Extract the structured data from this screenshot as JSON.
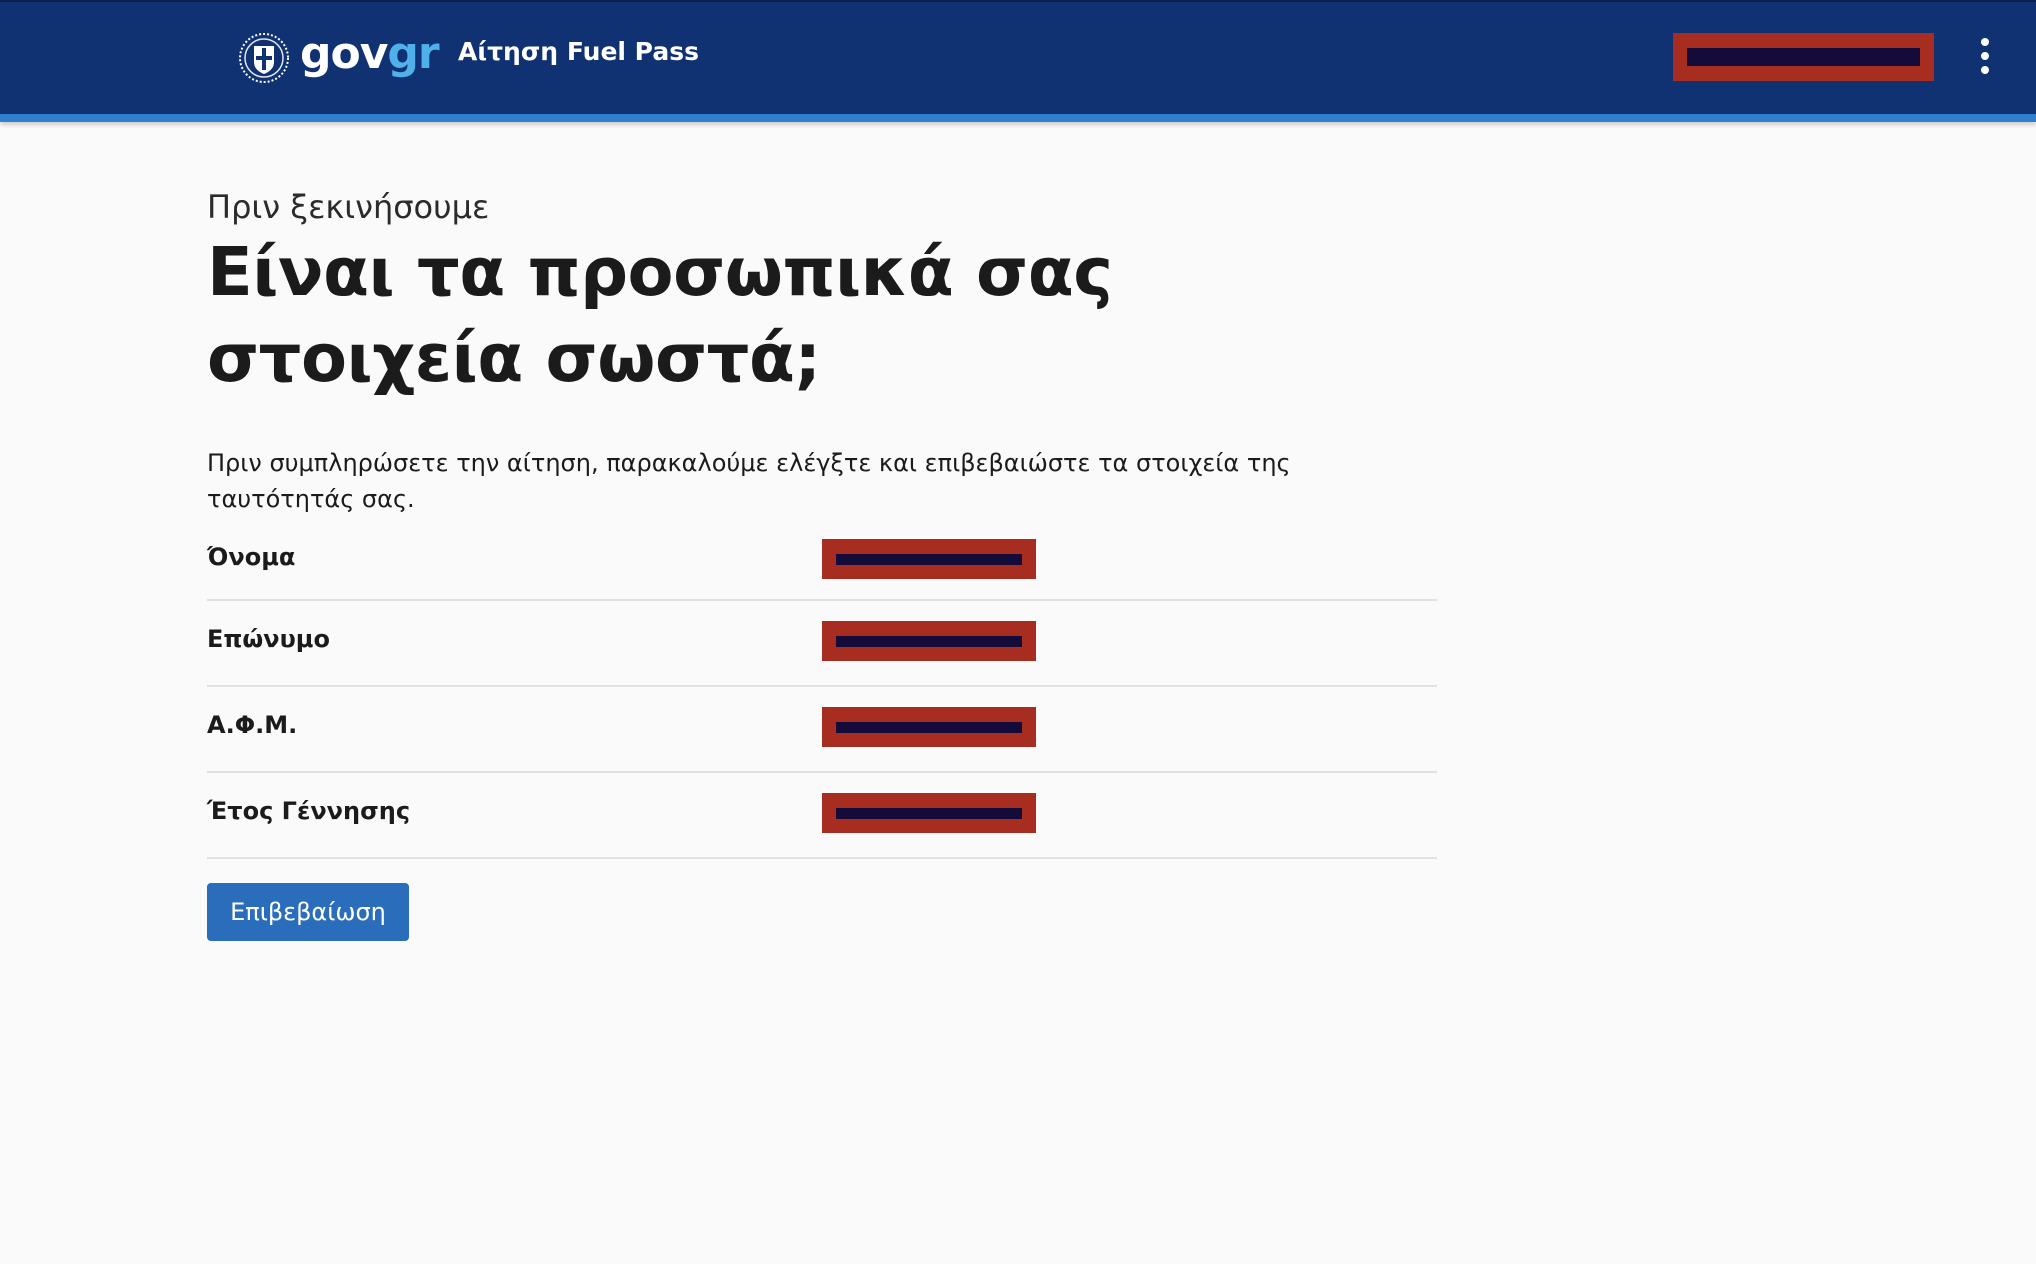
{
  "header": {
    "logo_gov": "gov",
    "logo_gr": "gr",
    "service_name": "Αίτηση Fuel Pass",
    "user_name_redacted": true,
    "menu_icon": "more-vertical-icon",
    "colors": {
      "background": "#113272",
      "stripe": "#2f7fcf",
      "logo_accent": "#4fb0ea"
    }
  },
  "main": {
    "caption": "Πριν ξεκινήσουμε",
    "title": "Είναι τα προσωπικά σας στοιχεία σωστά;",
    "intro": "Πριν συμπληρώσετε την αίτηση, παρακαλούμε ελέγξτε και επιβεβαιώστε τα στοιχεία της ταυτότητάς σας.",
    "fields": [
      {
        "label": "Όνομα",
        "value_redacted": true
      },
      {
        "label": "Επώνυμο",
        "value_redacted": true
      },
      {
        "label": "Α.Φ.Μ.",
        "value_redacted": true
      },
      {
        "label": "Έτος Γέννησης",
        "value_redacted": true
      }
    ],
    "confirm_label": "Επιβεβαίωση",
    "colors": {
      "button": "#2a6ebb",
      "redaction": "#a62d1f"
    }
  }
}
